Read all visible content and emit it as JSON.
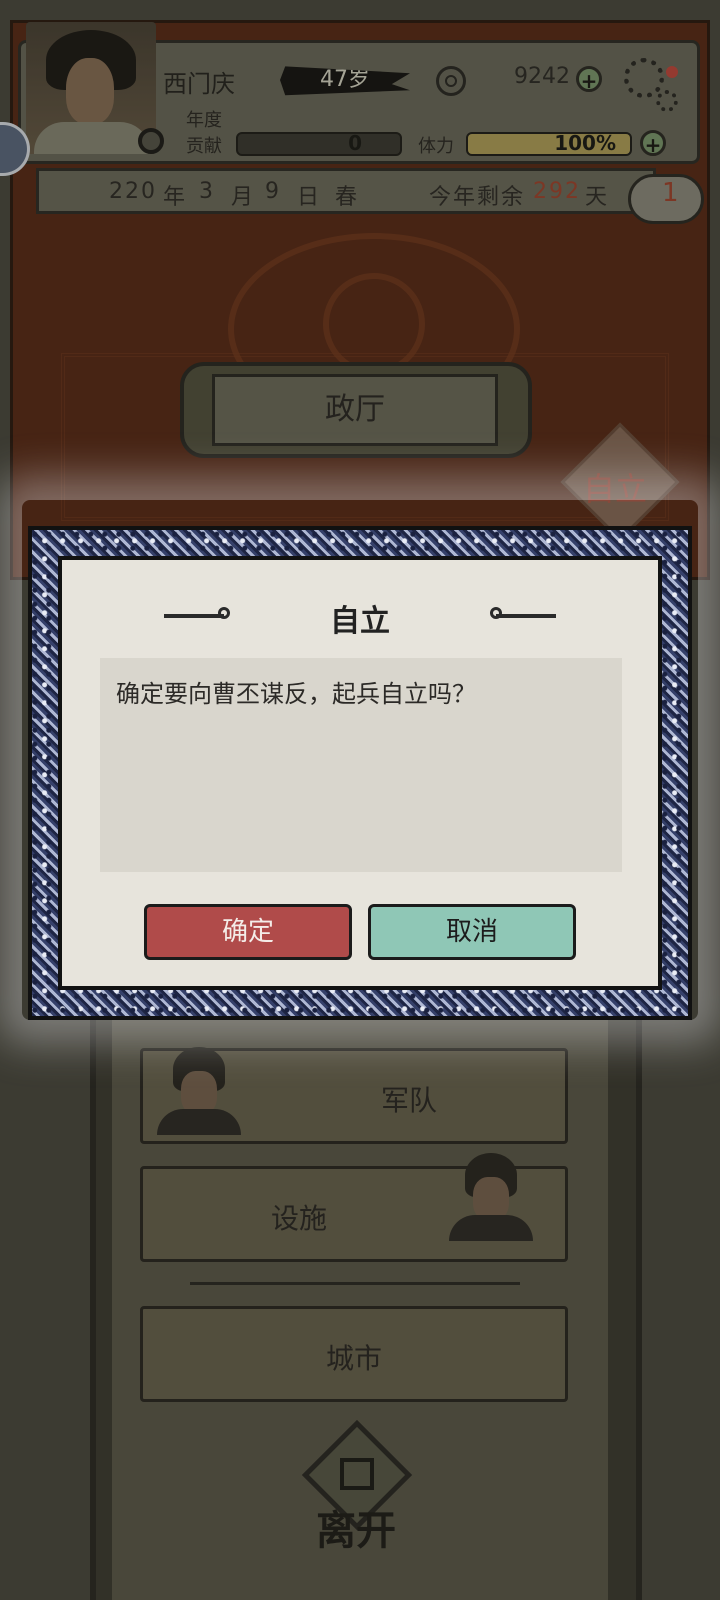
{
  "status": {
    "name": "西门庆",
    "age": "47岁",
    "coins": "9242",
    "annual_label": "年度",
    "contribution_label": "贡献",
    "contribution_value": "0",
    "stamina_label": "体力",
    "stamina_value": "100%",
    "stamina_fraction": 1.0
  },
  "date_bar": {
    "year": "220",
    "year_unit": "年",
    "month": "3",
    "month_unit": "月",
    "day": "9",
    "day_unit": "日",
    "season": "春",
    "remaining_label": "今年剩余",
    "remaining_days": "292",
    "days_unit": "天",
    "badge": "1"
  },
  "hall": {
    "title": "政厅",
    "independence_tag": "自立"
  },
  "menu": {
    "army": "军队",
    "facilities": "设施",
    "city": "城市",
    "leave": "离开"
  },
  "dialog": {
    "title": "自立",
    "message": "确定要向曹丕谋反，起兵自立吗？",
    "confirm": "确定",
    "cancel": "取消"
  },
  "colors": {
    "confirm_button": "#b04b4a",
    "cancel_button": "#8fc7b6",
    "remaining_days": "#a4442f"
  },
  "icons": [
    "coin-icon",
    "plus-icon",
    "settings-gear-icon",
    "search-icon",
    "play-icon",
    "exit-icon"
  ]
}
